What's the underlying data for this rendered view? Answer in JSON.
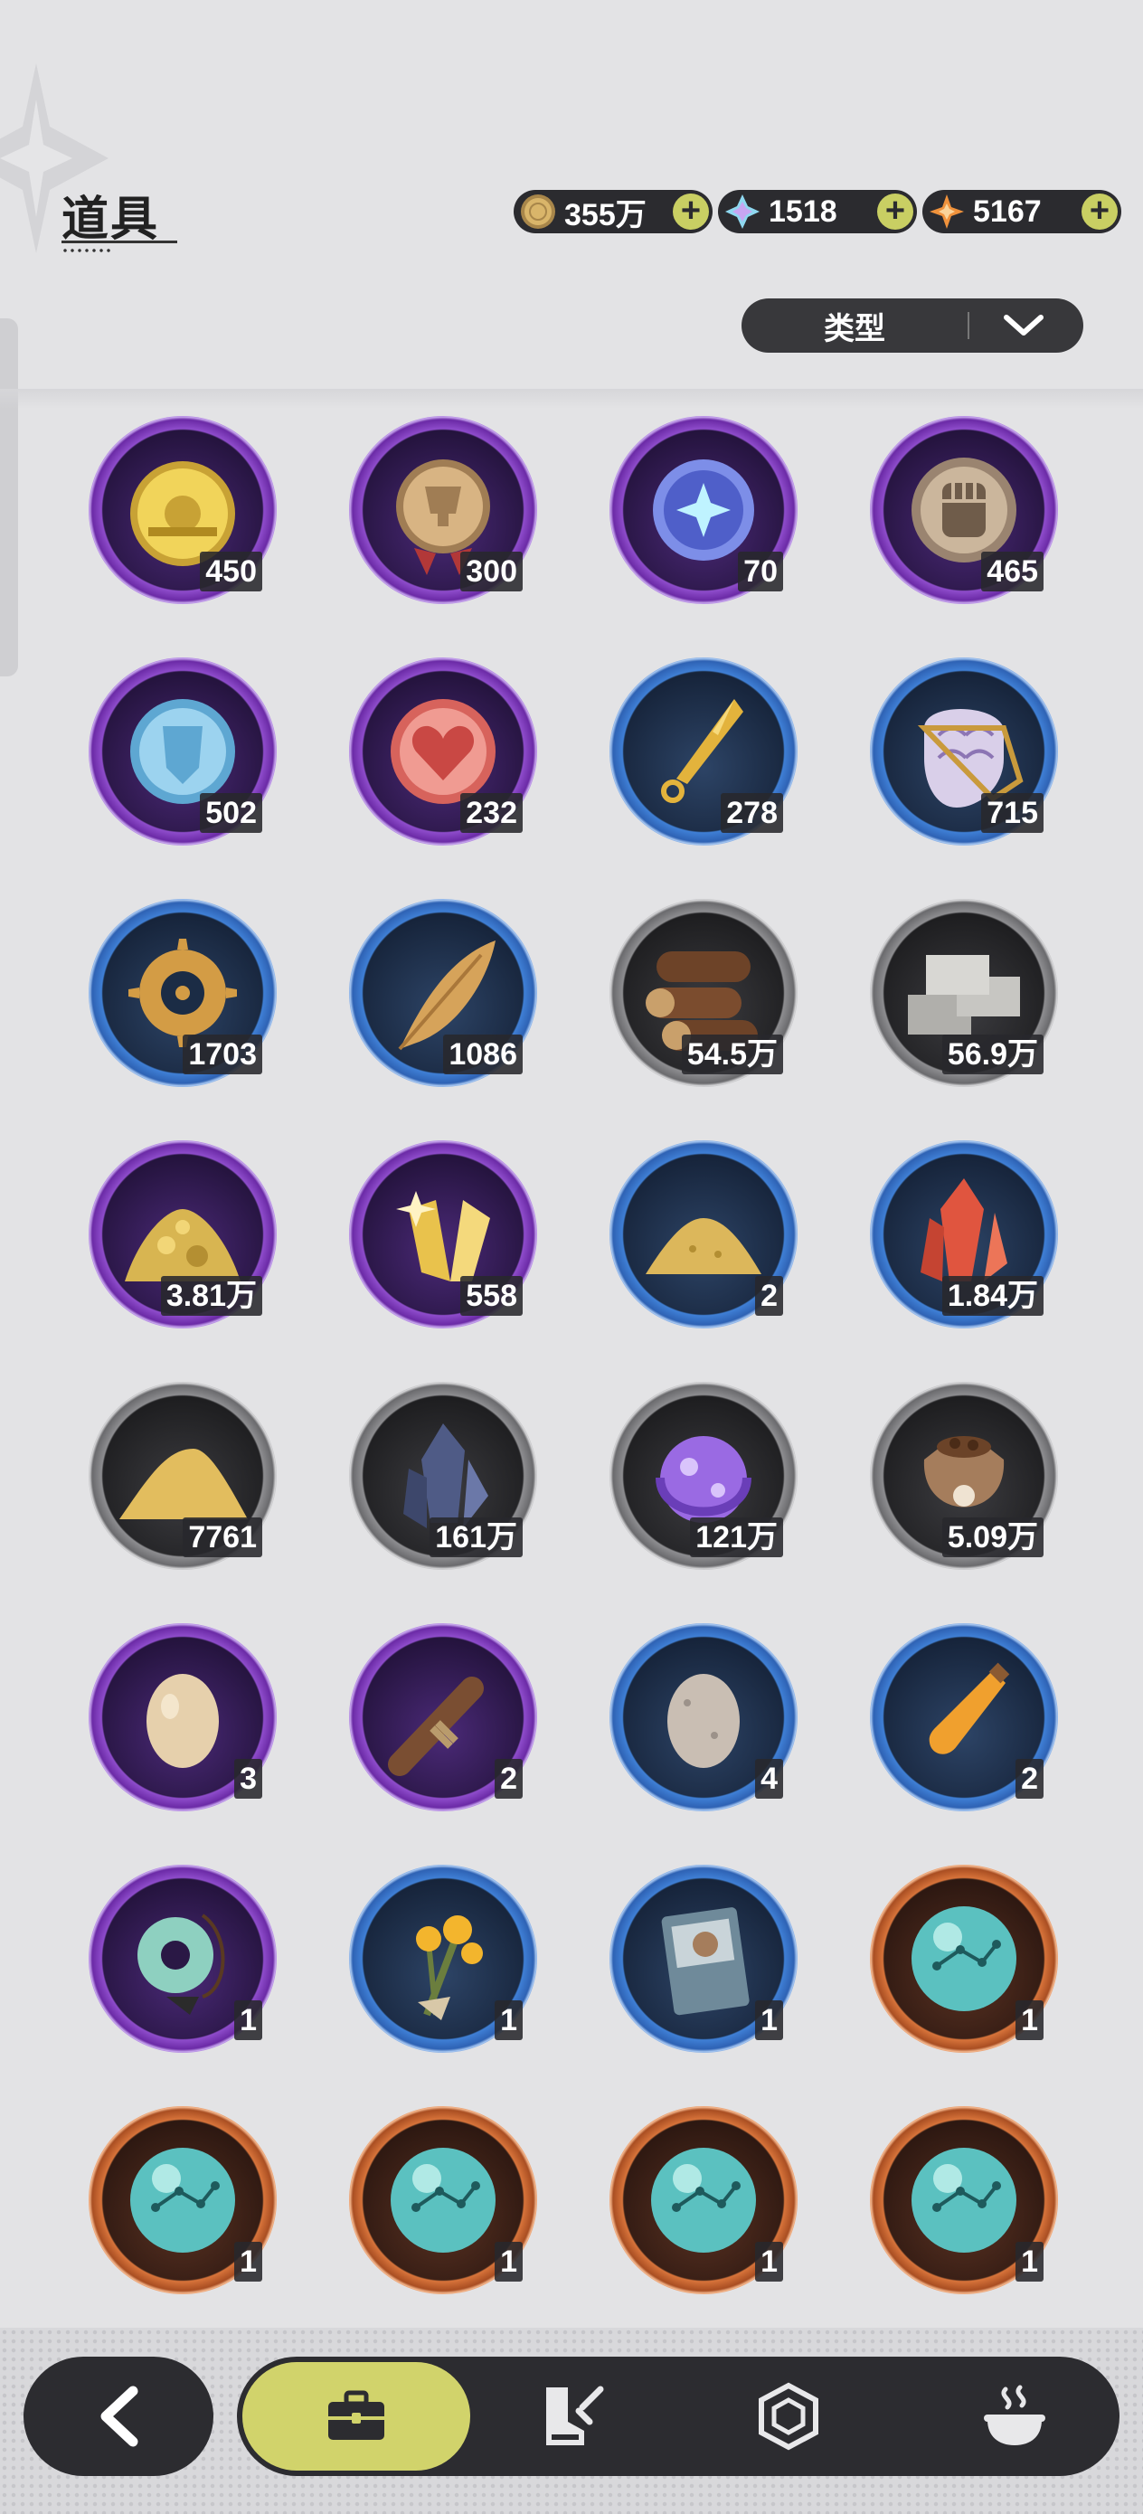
{
  "header": {
    "title": "道具"
  },
  "currencies": [
    {
      "icon": "gold-coin-icon",
      "amount": "355万"
    },
    {
      "icon": "crystal-gem-icon",
      "amount": "1518"
    },
    {
      "icon": "orange-star-gem-icon",
      "amount": "5167"
    }
  ],
  "filter": {
    "label": "类型"
  },
  "items": [
    {
      "name": "soccer-coin",
      "rarity": "purple",
      "count": "450"
    },
    {
      "name": "trophy-medal",
      "rarity": "purple",
      "count": "300"
    },
    {
      "name": "star-orb-coin",
      "rarity": "purple",
      "count": "70"
    },
    {
      "name": "fist-coin",
      "rarity": "purple",
      "count": "465"
    },
    {
      "name": "shield-coin",
      "rarity": "purple",
      "count": "502"
    },
    {
      "name": "heart-coin",
      "rarity": "purple",
      "count": "232"
    },
    {
      "name": "golden-blade",
      "rarity": "blue",
      "count": "278"
    },
    {
      "name": "dragon-scale",
      "rarity": "blue",
      "count": "715"
    },
    {
      "name": "golden-gear",
      "rarity": "blue",
      "count": "1703"
    },
    {
      "name": "golden-leaf",
      "rarity": "blue",
      "count": "1086"
    },
    {
      "name": "wood-logs",
      "rarity": "gray",
      "count": "54.5万"
    },
    {
      "name": "stone-bricks",
      "rarity": "gray",
      "count": "56.9万"
    },
    {
      "name": "gold-ore-pile",
      "rarity": "purple",
      "count": "3.81万"
    },
    {
      "name": "gold-crystal-shards",
      "rarity": "purple",
      "count": "558"
    },
    {
      "name": "gold-dust-pile",
      "rarity": "blue",
      "count": "2"
    },
    {
      "name": "red-crystal",
      "rarity": "blue",
      "count": "1.84万"
    },
    {
      "name": "sand-pile",
      "rarity": "gray",
      "count": "7761"
    },
    {
      "name": "blue-ore-crystal",
      "rarity": "gray",
      "count": "161万"
    },
    {
      "name": "purple-orb",
      "rarity": "gray",
      "count": "121万"
    },
    {
      "name": "seed-sack",
      "rarity": "gray",
      "count": "5.09万"
    },
    {
      "name": "brown-egg",
      "rarity": "purple",
      "count": "3"
    },
    {
      "name": "rope-bundle",
      "rarity": "purple",
      "count": "2"
    },
    {
      "name": "gray-egg",
      "rarity": "blue",
      "count": "4"
    },
    {
      "name": "potion-vial",
      "rarity": "blue",
      "count": "2"
    },
    {
      "name": "jade-pendant",
      "rarity": "purple",
      "count": "1"
    },
    {
      "name": "flower-bouquet",
      "rarity": "blue",
      "count": "1"
    },
    {
      "name": "recipe-card",
      "rarity": "blue",
      "count": "1"
    },
    {
      "name": "constellation-orb-1",
      "rarity": "orange",
      "count": "1"
    },
    {
      "name": "constellation-orb-2",
      "rarity": "orange",
      "count": "1"
    },
    {
      "name": "constellation-orb-3",
      "rarity": "orange",
      "count": "1"
    },
    {
      "name": "constellation-orb-4",
      "rarity": "orange",
      "count": "1"
    },
    {
      "name": "constellation-orb-5",
      "rarity": "orange",
      "count": "1"
    }
  ],
  "nav": {
    "back_icon": "back-arrow-icon",
    "tabs": [
      {
        "icon": "briefcase-icon",
        "active": true
      },
      {
        "icon": "boot-sword-icon",
        "active": false
      },
      {
        "icon": "hexagon-gem-icon",
        "active": false
      },
      {
        "icon": "cooking-pot-icon",
        "active": false
      }
    ]
  }
}
